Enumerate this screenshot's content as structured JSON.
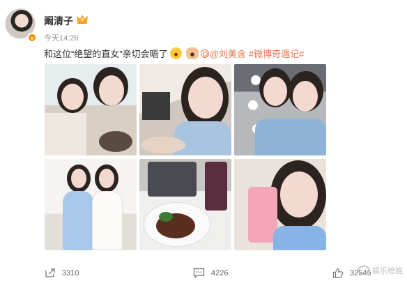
{
  "post": {
    "author": "阚清子",
    "time": "今天14:26",
    "text_before": "和这位“绝望的直女”亲切会晤了",
    "mention": "@刘美含",
    "hashtag": "#微博奇遇记#"
  },
  "photos": [
    {
      "id": "photo-1"
    },
    {
      "id": "photo-2"
    },
    {
      "id": "photo-3"
    },
    {
      "id": "photo-4"
    },
    {
      "id": "photo-5"
    },
    {
      "id": "photo-6"
    }
  ],
  "actions": {
    "repost_count": "3310",
    "comment_count": "4226",
    "like_count": "32546"
  },
  "watermark": "娱乐榜姐",
  "colors": {
    "link": "#eb7350",
    "vip_badge": "#f58a00",
    "muted": "#939393"
  },
  "icons": [
    "crown-icon",
    "shock-emoji-icon",
    "rabbit-emoji-icon",
    "mention-icon",
    "repost-icon",
    "comment-icon",
    "like-icon"
  ]
}
